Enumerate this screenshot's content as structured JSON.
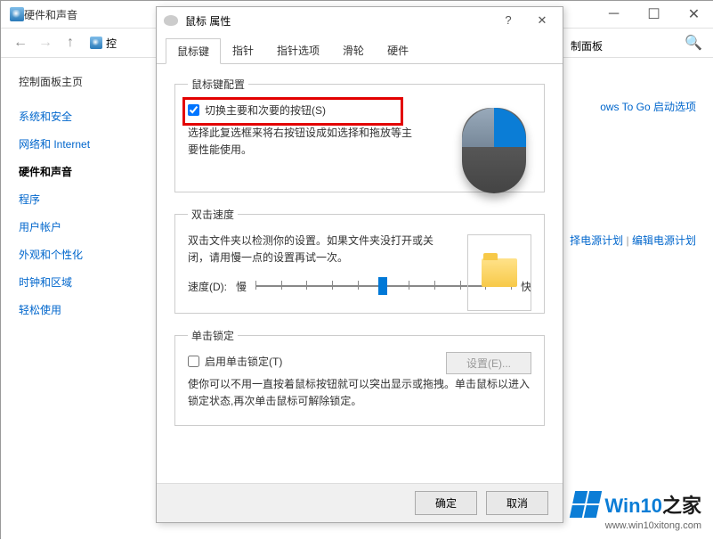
{
  "cp": {
    "title": "硬件和声音",
    "path_label": "控",
    "path_end": "制面板",
    "sidebar": {
      "home": "控制面板主页",
      "items": [
        "系统和安全",
        "网络和 Internet",
        "硬件和声音",
        "程序",
        "用户帐户",
        "外观和个性化",
        "时钟和区域",
        "轻松使用"
      ],
      "current_index": 2
    },
    "right_links": {
      "togo": "ows To Go 启动选项",
      "plan_left": "择电源计划",
      "plan_right": "编辑电源计划"
    }
  },
  "dialog": {
    "title": "鼠标 属性",
    "tabs": [
      "鼠标键",
      "指针",
      "指针选项",
      "滑轮",
      "硬件"
    ],
    "active_tab": 0,
    "group1": {
      "legend": "鼠标键配置",
      "checkbox_label": "切换主要和次要的按钮(S)",
      "checked": true,
      "desc": "选择此复选框来将右按钮设成如选择和拖放等主要性能使用。"
    },
    "group2": {
      "legend": "双击速度",
      "desc": "双击文件夹以检测你的设置。如果文件夹没打开或关闭，请用慢一点的设置再试一次。",
      "speed_label": "速度(D):",
      "slow": "慢",
      "fast": "快"
    },
    "group3": {
      "legend": "单击锁定",
      "checkbox_label": "启用单击锁定(T)",
      "checked": false,
      "settings_btn": "设置(E)...",
      "desc": "使你可以不用一直按着鼠标按钮就可以突出显示或拖拽。单击鼠标以进入锁定状态,再次单击鼠标可解除锁定。"
    },
    "buttons": {
      "ok": "确定",
      "cancel": "取消"
    }
  },
  "watermark": {
    "brand1": "Win10",
    "brand2": "之家",
    "url": "www.win10xitong.com"
  }
}
